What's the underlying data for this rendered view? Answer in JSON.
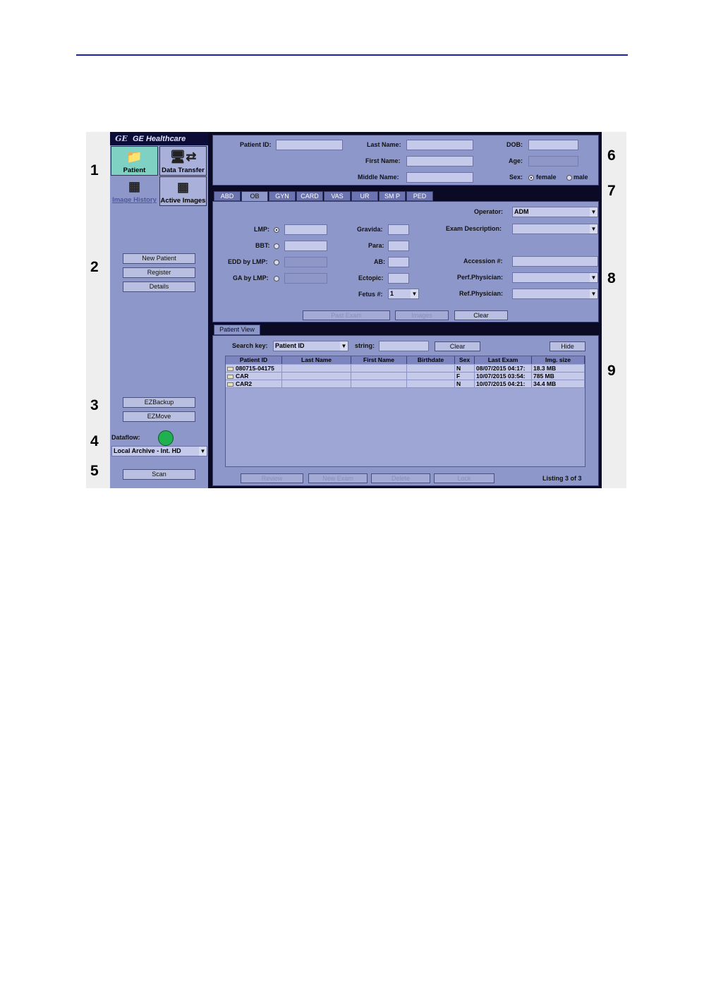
{
  "brand": "GE Healthcare",
  "callouts": [
    "1",
    "2",
    "3",
    "4",
    "5",
    "6",
    "7",
    "8",
    "9"
  ],
  "nav": {
    "patient": "Patient",
    "data_transfer": "Data Transfer",
    "image_history": "Image History",
    "active_images": "Active Images"
  },
  "sidebar": {
    "new_patient": "New Patient",
    "register": "Register",
    "details": "Details",
    "ezbackup": "EZBackup",
    "ezmove": "EZMove",
    "dataflow_label": "Dataflow:",
    "dataflow_value": "Local Archive - Int. HD",
    "scan": "Scan"
  },
  "patient_info": {
    "patient_id_label": "Patient ID:",
    "last_name_label": "Last Name:",
    "first_name_label": "First Name:",
    "middle_name_label": "Middle Name:",
    "dob_label": "DOB:",
    "age_label": "Age:",
    "sex_label": "Sex:",
    "female": "female",
    "male": "male",
    "sex_selected": "female"
  },
  "tabs": [
    "ABD",
    "OB",
    "GYN",
    "CARD",
    "VAS",
    "UR",
    "SM P",
    "PED"
  ],
  "active_tab": "OB",
  "exam": {
    "lmp": "LMP:",
    "bbt": "BBT:",
    "edd_by_lmp": "EDD by LMP:",
    "ga_by_lmp": "GA by LMP:",
    "gravida": "Gravida:",
    "para": "Para:",
    "ab": "AB:",
    "ectopic": "Ectopic:",
    "fetus": "Fetus #:",
    "fetus_value": "1",
    "operator_label": "Operator:",
    "operator_value": "ADM",
    "exam_description": "Exam Description:",
    "accession": "Accession #:",
    "perf_physician": "Perf.Physician:",
    "ref_physician": "Ref.Physician:",
    "past_exam": "Past Exam",
    "images": "Images",
    "clear": "Clear"
  },
  "patient_view": {
    "tab": "Patient View",
    "search_key_label": "Search key:",
    "search_key_value": "Patient ID",
    "string_label": "string:",
    "clear": "Clear",
    "hide": "Hide",
    "columns": [
      "Patient ID",
      "Last Name",
      "First Name",
      "Birthdate",
      "Sex",
      "Last Exam",
      "Img. size"
    ],
    "rows": [
      [
        "080715-04175",
        "",
        "",
        "",
        "N",
        "08/07/2015 04:17:",
        "18.3 MB"
      ],
      [
        "CAR",
        "",
        "",
        "",
        "F",
        "10/07/2015 03:54:",
        "785 MB"
      ],
      [
        "CAR2",
        "",
        "",
        "",
        "N",
        "10/07/2015 04:21:",
        "34.4 MB"
      ]
    ],
    "review": "Review",
    "new_exam": "New Exam",
    "delete": "Delete",
    "lock": "Lock",
    "listing": "Listing 3 of 3"
  }
}
